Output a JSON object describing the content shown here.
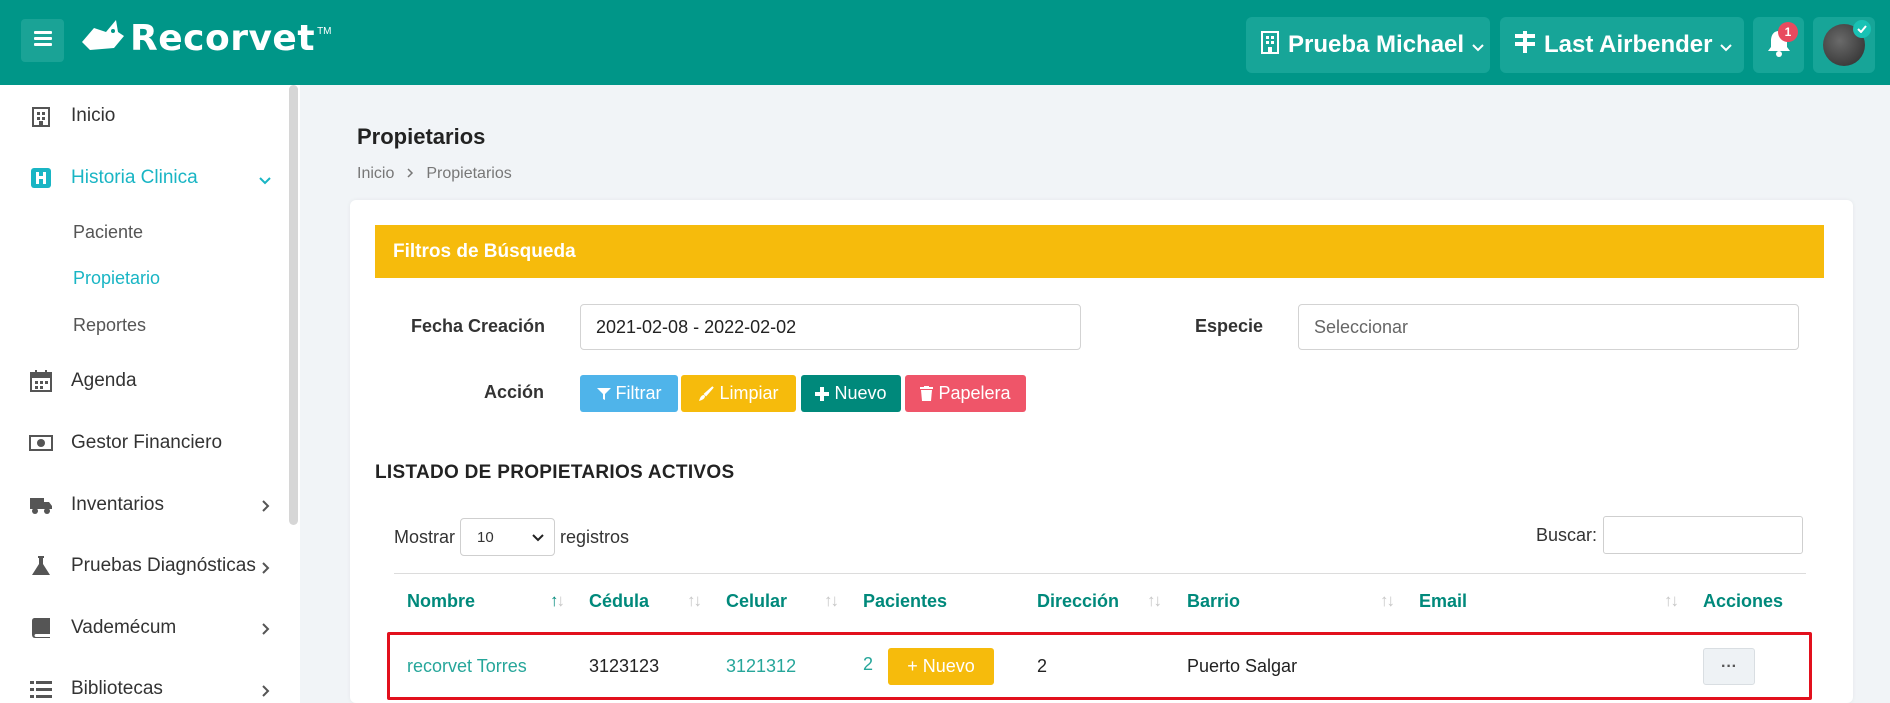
{
  "app": {
    "logo_text": "Recorvet",
    "logo_tm": "TM"
  },
  "header": {
    "clinic_label": "Prueba Michael",
    "user_label": "Last Airbender",
    "notification_count": "1"
  },
  "sidebar": {
    "items": [
      {
        "label": "Inicio",
        "icon": "hospital-icon"
      },
      {
        "label": "Historia Clinica",
        "icon": "h-square-icon"
      },
      {
        "label": "Agenda",
        "icon": "calendar-icon"
      },
      {
        "label": "Gestor Financiero",
        "icon": "money-bill-icon"
      },
      {
        "label": "Inventarios",
        "icon": "truck-icon"
      },
      {
        "label": "Pruebas Diagnósticas",
        "icon": "flask-icon"
      },
      {
        "label": "Vademécum",
        "icon": "book-icon"
      },
      {
        "label": "Bibliotecas",
        "icon": "list-icon"
      }
    ],
    "sub_items": [
      "Paciente",
      "Propietario",
      "Reportes"
    ]
  },
  "page": {
    "title": "Propietarios",
    "breadcrumb": [
      "Inicio",
      "Propietarios"
    ]
  },
  "filters": {
    "header": "Filtros de Búsqueda",
    "fecha_label": "Fecha Creación",
    "fecha_value": "2021-02-08 - 2022-02-02",
    "especie_label": "Especie",
    "especie_placeholder": "Seleccionar",
    "accion_label": "Acción",
    "btn_filtrar": "Filtrar",
    "btn_limpiar": "Limpiar",
    "btn_nuevo": "Nuevo",
    "btn_papelera": "Papelera"
  },
  "list": {
    "title": "LISTADO DE PROPIETARIOS ACTIVOS",
    "mostrar": "Mostrar",
    "length_value": "10",
    "registros": "registros",
    "buscar": "Buscar:",
    "columns": [
      "Nombre",
      "Cédula",
      "Celular",
      "Pacientes",
      "Dirección",
      "Barrio",
      "Email",
      "Acciones"
    ],
    "rows": [
      {
        "nombre": "recorvet Torres",
        "cedula": "3123123",
        "celular": "3121312",
        "pacientes": "2",
        "nuevo_label": "+ Nuevo",
        "direccion": "2",
        "barrio": "Puerto Salgar",
        "email": "",
        "acciones": "···"
      }
    ]
  },
  "colors": {
    "primary": "#009688",
    "accent": "#19b5c4",
    "warning": "#f6bb0c",
    "info": "#4fb4ea",
    "danger": "#ef5569",
    "highlight": "#e2101d"
  }
}
